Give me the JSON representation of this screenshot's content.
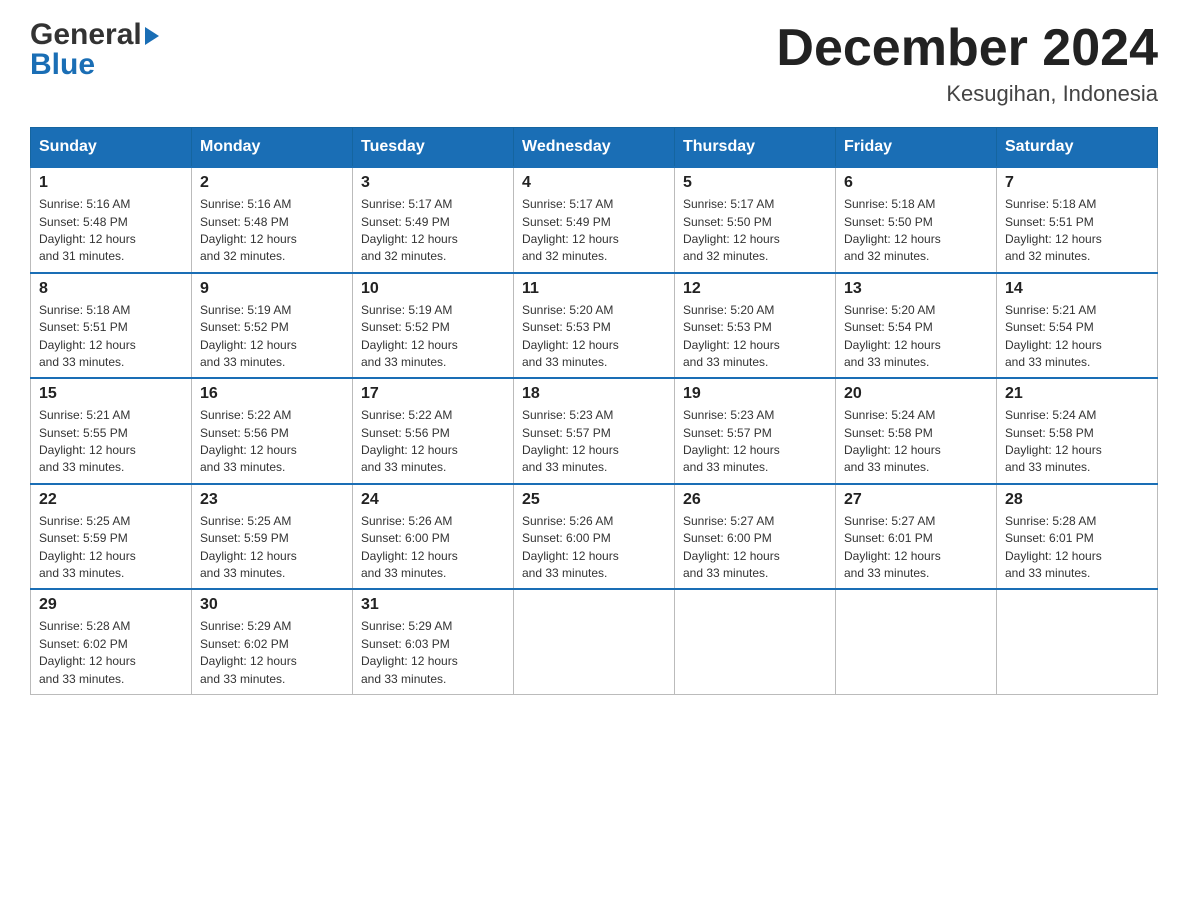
{
  "logo": {
    "general": "General",
    "blue": "Blue",
    "arrow": "▶"
  },
  "title": "December 2024",
  "location": "Kesugihan, Indonesia",
  "days_of_week": [
    "Sunday",
    "Monday",
    "Tuesday",
    "Wednesday",
    "Thursday",
    "Friday",
    "Saturday"
  ],
  "weeks": [
    [
      {
        "day": "1",
        "sunrise": "5:16 AM",
        "sunset": "5:48 PM",
        "daylight": "12 hours and 31 minutes."
      },
      {
        "day": "2",
        "sunrise": "5:16 AM",
        "sunset": "5:48 PM",
        "daylight": "12 hours and 32 minutes."
      },
      {
        "day": "3",
        "sunrise": "5:17 AM",
        "sunset": "5:49 PM",
        "daylight": "12 hours and 32 minutes."
      },
      {
        "day": "4",
        "sunrise": "5:17 AM",
        "sunset": "5:49 PM",
        "daylight": "12 hours and 32 minutes."
      },
      {
        "day": "5",
        "sunrise": "5:17 AM",
        "sunset": "5:50 PM",
        "daylight": "12 hours and 32 minutes."
      },
      {
        "day": "6",
        "sunrise": "5:18 AM",
        "sunset": "5:50 PM",
        "daylight": "12 hours and 32 minutes."
      },
      {
        "day": "7",
        "sunrise": "5:18 AM",
        "sunset": "5:51 PM",
        "daylight": "12 hours and 32 minutes."
      }
    ],
    [
      {
        "day": "8",
        "sunrise": "5:18 AM",
        "sunset": "5:51 PM",
        "daylight": "12 hours and 33 minutes."
      },
      {
        "day": "9",
        "sunrise": "5:19 AM",
        "sunset": "5:52 PM",
        "daylight": "12 hours and 33 minutes."
      },
      {
        "day": "10",
        "sunrise": "5:19 AM",
        "sunset": "5:52 PM",
        "daylight": "12 hours and 33 minutes."
      },
      {
        "day": "11",
        "sunrise": "5:20 AM",
        "sunset": "5:53 PM",
        "daylight": "12 hours and 33 minutes."
      },
      {
        "day": "12",
        "sunrise": "5:20 AM",
        "sunset": "5:53 PM",
        "daylight": "12 hours and 33 minutes."
      },
      {
        "day": "13",
        "sunrise": "5:20 AM",
        "sunset": "5:54 PM",
        "daylight": "12 hours and 33 minutes."
      },
      {
        "day": "14",
        "sunrise": "5:21 AM",
        "sunset": "5:54 PM",
        "daylight": "12 hours and 33 minutes."
      }
    ],
    [
      {
        "day": "15",
        "sunrise": "5:21 AM",
        "sunset": "5:55 PM",
        "daylight": "12 hours and 33 minutes."
      },
      {
        "day": "16",
        "sunrise": "5:22 AM",
        "sunset": "5:56 PM",
        "daylight": "12 hours and 33 minutes."
      },
      {
        "day": "17",
        "sunrise": "5:22 AM",
        "sunset": "5:56 PM",
        "daylight": "12 hours and 33 minutes."
      },
      {
        "day": "18",
        "sunrise": "5:23 AM",
        "sunset": "5:57 PM",
        "daylight": "12 hours and 33 minutes."
      },
      {
        "day": "19",
        "sunrise": "5:23 AM",
        "sunset": "5:57 PM",
        "daylight": "12 hours and 33 minutes."
      },
      {
        "day": "20",
        "sunrise": "5:24 AM",
        "sunset": "5:58 PM",
        "daylight": "12 hours and 33 minutes."
      },
      {
        "day": "21",
        "sunrise": "5:24 AM",
        "sunset": "5:58 PM",
        "daylight": "12 hours and 33 minutes."
      }
    ],
    [
      {
        "day": "22",
        "sunrise": "5:25 AM",
        "sunset": "5:59 PM",
        "daylight": "12 hours and 33 minutes."
      },
      {
        "day": "23",
        "sunrise": "5:25 AM",
        "sunset": "5:59 PM",
        "daylight": "12 hours and 33 minutes."
      },
      {
        "day": "24",
        "sunrise": "5:26 AM",
        "sunset": "6:00 PM",
        "daylight": "12 hours and 33 minutes."
      },
      {
        "day": "25",
        "sunrise": "5:26 AM",
        "sunset": "6:00 PM",
        "daylight": "12 hours and 33 minutes."
      },
      {
        "day": "26",
        "sunrise": "5:27 AM",
        "sunset": "6:00 PM",
        "daylight": "12 hours and 33 minutes."
      },
      {
        "day": "27",
        "sunrise": "5:27 AM",
        "sunset": "6:01 PM",
        "daylight": "12 hours and 33 minutes."
      },
      {
        "day": "28",
        "sunrise": "5:28 AM",
        "sunset": "6:01 PM",
        "daylight": "12 hours and 33 minutes."
      }
    ],
    [
      {
        "day": "29",
        "sunrise": "5:28 AM",
        "sunset": "6:02 PM",
        "daylight": "12 hours and 33 minutes."
      },
      {
        "day": "30",
        "sunrise": "5:29 AM",
        "sunset": "6:02 PM",
        "daylight": "12 hours and 33 minutes."
      },
      {
        "day": "31",
        "sunrise": "5:29 AM",
        "sunset": "6:03 PM",
        "daylight": "12 hours and 33 minutes."
      },
      null,
      null,
      null,
      null
    ]
  ],
  "labels": {
    "sunrise": "Sunrise:",
    "sunset": "Sunset:",
    "daylight": "Daylight:"
  }
}
